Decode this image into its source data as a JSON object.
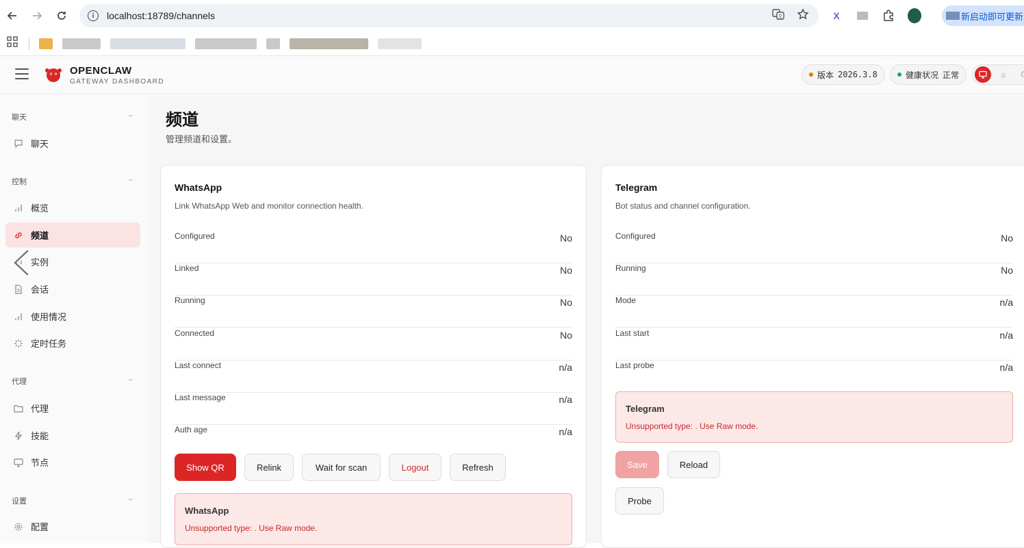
{
  "browser": {
    "url": "localhost:18789/channels",
    "update_label": "新启动即可更新"
  },
  "header": {
    "brand_title": "OPENCLAW",
    "brand_subtitle": "GATEWAY DASHBOARD",
    "version_label": "版本",
    "version_value": "2026.3.8",
    "health_label": "健康状况",
    "health_value": "正常",
    "colors": {
      "accent": "#dc2626",
      "version_dot": "#e07b00",
      "health_dot": "#22a559"
    }
  },
  "sidebar": {
    "groups": [
      {
        "title": "聊天",
        "items": [
          {
            "label": "聊天",
            "icon": "chat-bubble-icon"
          }
        ]
      },
      {
        "title": "控制",
        "items": [
          {
            "label": "概览",
            "icon": "bar-chart-icon"
          },
          {
            "label": "频道",
            "icon": "link-icon",
            "active": true
          },
          {
            "label": "实例",
            "icon": "radio-icon"
          },
          {
            "label": "会话",
            "icon": "document-icon"
          },
          {
            "label": "使用情况",
            "icon": "bar-chart-icon"
          },
          {
            "label": "定时任务",
            "icon": "loader-icon"
          }
        ]
      },
      {
        "title": "代理",
        "items": [
          {
            "label": "代理",
            "icon": "folder-icon"
          },
          {
            "label": "技能",
            "icon": "lightning-icon"
          },
          {
            "label": "节点",
            "icon": "monitor-icon"
          }
        ]
      },
      {
        "title": "设置",
        "items": [
          {
            "label": "配置",
            "icon": "gear-icon"
          }
        ]
      }
    ],
    "collapse_glyph": "–"
  },
  "page": {
    "title": "频道",
    "subtitle": "管理频道和设置。"
  },
  "whatsapp": {
    "title": "WhatsApp",
    "description": "Link WhatsApp Web and monitor connection health.",
    "rows": [
      {
        "key": "Configured",
        "value": "No"
      },
      {
        "key": "Linked",
        "value": "No"
      },
      {
        "key": "Running",
        "value": "No"
      },
      {
        "key": "Connected",
        "value": "No"
      },
      {
        "key": "Last connect",
        "value": "n/a"
      },
      {
        "key": "Last message",
        "value": "n/a"
      },
      {
        "key": "Auth age",
        "value": "n/a"
      }
    ],
    "buttons": {
      "show_qr": "Show QR",
      "relink": "Relink",
      "wait_for_scan": "Wait for scan",
      "logout": "Logout",
      "refresh": "Refresh"
    },
    "alert": {
      "title": "WhatsApp",
      "message": "Unsupported type: . Use Raw mode."
    }
  },
  "telegram": {
    "title": "Telegram",
    "description": "Bot status and channel configuration.",
    "rows": [
      {
        "key": "Configured",
        "value": "No"
      },
      {
        "key": "Running",
        "value": "No"
      },
      {
        "key": "Mode",
        "value": "n/a"
      },
      {
        "key": "Last start",
        "value": "n/a"
      },
      {
        "key": "Last probe",
        "value": "n/a"
      }
    ],
    "alert": {
      "title": "Telegram",
      "message": "Unsupported type: . Use Raw mode."
    },
    "buttons": {
      "save": "Save",
      "reload": "Reload",
      "probe": "Probe"
    }
  }
}
